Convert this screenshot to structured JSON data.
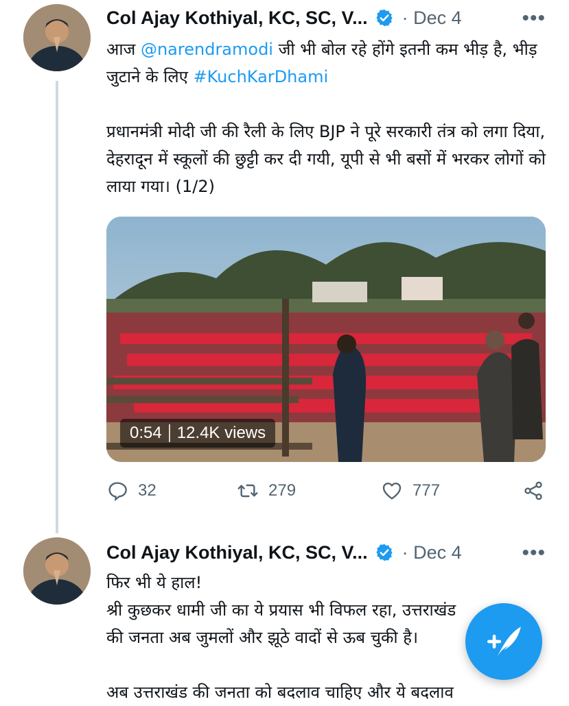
{
  "tweets": [
    {
      "author": "Col Ajay Kothiyal, KC, SC, V...",
      "date": "· Dec 4",
      "more": "•••",
      "line1_pre": "आज ",
      "mention": "@narendramodi",
      "line1_post": " जी भी बोल रहे होंगे इतनी कम भीड़ है, भीड़ जुटाने के लिए ",
      "hashtag": "#KuchKarDhami",
      "para2": "प्रधानमंत्री मोदी जी की रैली के लिए BJP ने पूरे सरकारी तंत्र को लगा दिया, देहरादून में स्कूलों की छुट्टी कर दी गयी, यूपी से भी बसों में भरकर लोगों को लाया गया। (1/2)",
      "video": {
        "duration": "0:54",
        "views": "12.4K views"
      },
      "actions": {
        "replies": "32",
        "retweets": "279",
        "likes": "777"
      }
    },
    {
      "author": "Col Ajay Kothiyal, KC, SC, V...",
      "date": "· Dec 4",
      "more": "•••",
      "line1": "फिर भी ये हाल!",
      "line2": "श्री कुछकर धामी जी का ये प्रयास भी विफल रहा, उत्तराखंड",
      "line3": "की जनता अब जुमलों और झूठे वादों से ऊब चुकी है।",
      "line4": "अब उत्तराखंड की जनता को बदलाव चाहिए और ये बदलाव"
    }
  ],
  "icons": {
    "verified": "verified-badge-icon",
    "reply": "reply-icon",
    "retweet": "retweet-icon",
    "like": "heart-icon",
    "share": "share-icon",
    "compose": "compose-tweet-icon"
  },
  "colors": {
    "accent": "#1d9bf0",
    "muted": "#536471",
    "text": "#0f1419"
  }
}
